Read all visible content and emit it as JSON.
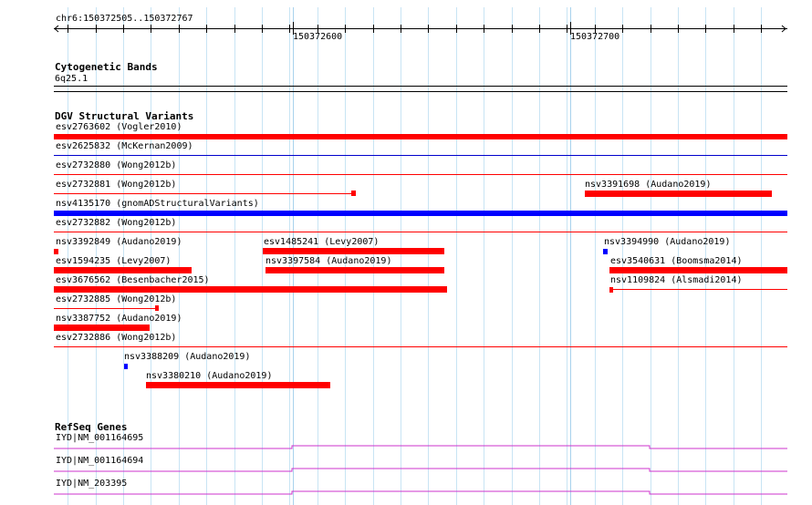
{
  "ruler": {
    "location": "chr6:150372505..150372767",
    "tick_labels": [
      "150372600",
      "150372700"
    ]
  },
  "tracks": {
    "cytoband": {
      "title": "Cytogenetic Bands",
      "band": "6q25.1"
    },
    "dgv": {
      "title": "DGV Structural Variants",
      "features": [
        {
          "label": "esv2763602 (Vogler2010)",
          "color": "#ff0000",
          "kind": "bar"
        },
        {
          "label": "esv2625832 (McKernan2009)",
          "color": "#0000cc",
          "kind": "line"
        },
        {
          "label": "esv2732880 (Wong2012b)",
          "color": "#ff0000",
          "kind": "line"
        },
        {
          "label": "esv2732881 (Wong2012b)",
          "color": "#ff0000",
          "kind": "line"
        },
        {
          "label": "nsv3391698 (Audano2019)",
          "color": "#ff0000",
          "kind": "bar"
        },
        {
          "label": "nsv4135170 (gnomADStructuralVariants)",
          "color": "#0000ff",
          "kind": "bar"
        },
        {
          "label": "esv2732882 (Wong2012b)",
          "color": "#ff0000",
          "kind": "line"
        },
        {
          "label": "nsv3392849 (Audano2019)",
          "color": "#ff0000",
          "kind": "bar"
        },
        {
          "label": "esv1485241 (Levy2007)",
          "color": "#ff0000",
          "kind": "bar"
        },
        {
          "label": "nsv3394990 (Audano2019)",
          "color": "#0000ff",
          "kind": "bar"
        },
        {
          "label": "esv1594235 (Levy2007)",
          "color": "#ff0000",
          "kind": "bar"
        },
        {
          "label": "nsv3397584 (Audano2019)",
          "color": "#ff0000",
          "kind": "bar"
        },
        {
          "label": "esv3540631 (Boomsma2014)",
          "color": "#ff0000",
          "kind": "bar"
        },
        {
          "label": "esv3676562 (Besenbacher2015)",
          "color": "#ff0000",
          "kind": "bar"
        },
        {
          "label": "nsv1109824 (Alsmadi2014)",
          "color": "#ff0000",
          "kind": "line"
        },
        {
          "label": "esv2732885 (Wong2012b)",
          "color": "#ff0000",
          "kind": "line"
        },
        {
          "label": "nsv3387752 (Audano2019)",
          "color": "#ff0000",
          "kind": "bar"
        },
        {
          "label": "esv2732886 (Wong2012b)",
          "color": "#ff0000",
          "kind": "line"
        },
        {
          "label": "nsv3388209 (Audano2019)",
          "color": "#0000ff",
          "kind": "bar"
        },
        {
          "label": "nsv3380210 (Audano2019)",
          "color": "#ff0000",
          "kind": "bar"
        }
      ]
    },
    "refseq": {
      "title": "RefSeq Genes",
      "genes": [
        {
          "label": "IYD|NM_001164695",
          "color": "#cc33cc"
        },
        {
          "label": "IYD|NM_001164694",
          "color": "#cc33cc"
        },
        {
          "label": "IYD|NM_203395",
          "color": "#cc33cc"
        }
      ]
    }
  }
}
